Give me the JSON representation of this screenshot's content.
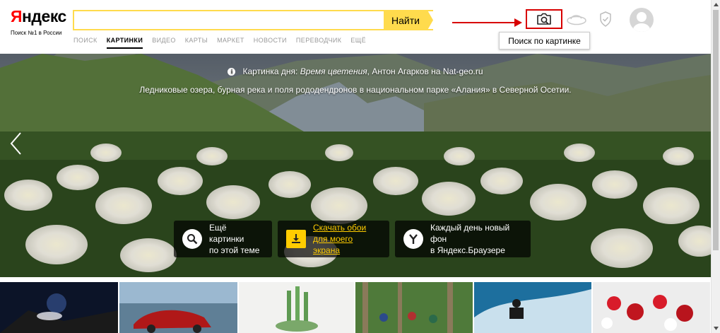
{
  "logo": {
    "text_red": "Я",
    "text_rest": "ндекс",
    "subtitle": "Поиск №1 в России"
  },
  "search": {
    "value": "",
    "placeholder": "",
    "button_label": "Найти"
  },
  "tabs": [
    {
      "label": "ПОИСК",
      "active": false
    },
    {
      "label": "КАРТИНКИ",
      "active": true
    },
    {
      "label": "ВИДЕО",
      "active": false
    },
    {
      "label": "КАРТЫ",
      "active": false
    },
    {
      "label": "МАРКЕТ",
      "active": false
    },
    {
      "label": "НОВОСТИ",
      "active": false
    },
    {
      "label": "ПЕРЕВОДЧИК",
      "active": false
    },
    {
      "label": "ЕЩЁ",
      "active": false
    }
  ],
  "header_icons": {
    "camera": "camera-search-icon",
    "cloud": "cloud-icon",
    "shield": "shield-icon",
    "avatar": "user-avatar"
  },
  "tooltip": {
    "text": "Поиск по картинке"
  },
  "hero": {
    "caption_prefix": "Картинка дня: ",
    "caption_title": "Время цветения",
    "caption_suffix": ", Антон Агарков на Nat-geo.ru",
    "subtitle": "Ледниковые озера, бурная река и поля рододендронов в национальном парке «Алания» в Северной Осетии."
  },
  "cards": [
    {
      "line1": "Ещё картинки",
      "line2": "по этой теме",
      "icon": "search-icon"
    },
    {
      "line1": "Скачать обои",
      "line2": "для моего экрана",
      "icon": "download-icon"
    },
    {
      "line1": "Каждый день новый фон",
      "line2": "в Яндекс.Браузере",
      "icon": "yandex-browser-icon"
    }
  ],
  "colors": {
    "brand_yellow": "#ffdb4d",
    "highlight_red": "#d80000",
    "logo_red": "#ff0000",
    "download_yellow": "#ffcc00"
  }
}
